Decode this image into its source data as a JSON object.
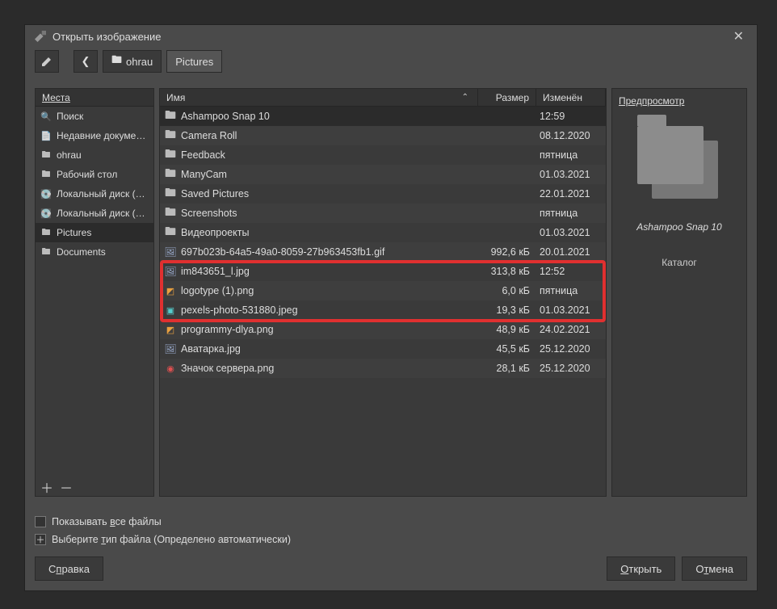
{
  "title": "Открыть изображение",
  "path": {
    "parent": "ohrau",
    "current": "Pictures"
  },
  "headers": {
    "places": "Места",
    "name": "Имя",
    "size": "Размер",
    "modified": "Изменён",
    "preview": "Предпросмотр"
  },
  "places": [
    {
      "icon": "search",
      "label": "Поиск"
    },
    {
      "icon": "recent",
      "label": "Недавние докуме…"
    },
    {
      "icon": "folder",
      "label": "ohrau"
    },
    {
      "icon": "folder",
      "label": "Рабочий стол"
    },
    {
      "icon": "disk",
      "label": "Локальный диск (…"
    },
    {
      "icon": "disk",
      "label": "Локальный диск (…"
    },
    {
      "icon": "folder",
      "label": "Pictures",
      "selected": true
    },
    {
      "icon": "folder",
      "label": "Documents"
    }
  ],
  "files": [
    {
      "ico": "folder",
      "name": "Ashampoo Snap 10",
      "size": "",
      "mod": "12:59",
      "selected": true
    },
    {
      "ico": "folder",
      "name": "Camera Roll",
      "size": "",
      "mod": "08.12.2020"
    },
    {
      "ico": "folder",
      "name": "Feedback",
      "size": "",
      "mod": "пятница"
    },
    {
      "ico": "folder",
      "name": "ManyCam",
      "size": "",
      "mod": "01.03.2021"
    },
    {
      "ico": "folder",
      "name": "Saved Pictures",
      "size": "",
      "mod": "22.01.2021"
    },
    {
      "ico": "folder",
      "name": "Screenshots",
      "size": "",
      "mod": "пятница"
    },
    {
      "ico": "folder",
      "name": "Видеопроекты",
      "size": "",
      "mod": "01.03.2021"
    },
    {
      "ico": "img",
      "name": "697b023b-64a5-49a0-8059-27b963453fb1.gif",
      "size": "992,6 кБ",
      "mod": "20.01.2021"
    },
    {
      "ico": "img",
      "name": "im843651_l.jpg",
      "size": "313,8 кБ",
      "mod": "12:52"
    },
    {
      "ico": "img2",
      "name": "logotype (1).png",
      "size": "6,0 кБ",
      "mod": "пятница"
    },
    {
      "ico": "img3",
      "name": "pexels-photo-531880.jpeg",
      "size": "19,3 кБ",
      "mod": "01.03.2021"
    },
    {
      "ico": "img2",
      "name": "programmy-dlya.png",
      "size": "48,9 кБ",
      "mod": "24.02.2021"
    },
    {
      "ico": "img",
      "name": "Аватарка.jpg",
      "size": "45,5 кБ",
      "mod": "25.12.2020"
    },
    {
      "ico": "img4",
      "name": "Значок сервера.png",
      "size": "28,1 кБ",
      "mod": "25.12.2020"
    }
  ],
  "preview": {
    "name": "Ashampoo Snap 10",
    "type": "Каталог"
  },
  "showAll": {
    "label_pre": "Показывать ",
    "label_u": "в",
    "label_post": "се файлы"
  },
  "fileType": {
    "label_pre": "Выберите ",
    "label_u": "т",
    "label_mid": "ип файла (",
    "value": "Определено автоматически",
    "label_post": ")"
  },
  "buttons": {
    "help_pre": "С",
    "help_u": "п",
    "help_post": "равка",
    "open_pre": "",
    "open_u": "О",
    "open_post": "ткрыть",
    "cancel_pre": "О",
    "cancel_u": "т",
    "cancel_post": "мена"
  }
}
